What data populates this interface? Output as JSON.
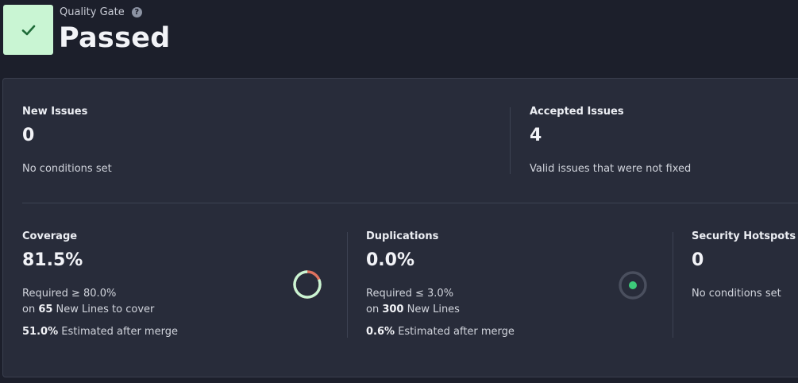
{
  "quality_gate": {
    "label": "Quality Gate",
    "help_icon": "?",
    "status": "Passed",
    "status_color": "#c9f5d3",
    "check_color": "#1e6b38"
  },
  "new_issues": {
    "title": "New Issues",
    "value": "0",
    "description": "No conditions set"
  },
  "accepted_issues": {
    "title": "Accepted Issues",
    "value": "4",
    "description": "Valid issues that were not fixed"
  },
  "coverage": {
    "title": "Coverage",
    "value": "81.5%",
    "required": "Required ≥ 80.0%",
    "on_prefix": "on ",
    "lines_count": "65",
    "lines_suffix": " New Lines to cover",
    "estimate_value": "51.0%",
    "estimate_suffix": " Estimated after merge",
    "ring_fraction": 0.815,
    "ring_covered_color": "#c9f5d3",
    "ring_uncovered_color": "#e0725f"
  },
  "duplications": {
    "title": "Duplications",
    "value": "0.0%",
    "required": "Required ≤ 3.0%",
    "on_prefix": "on ",
    "lines_count": "300",
    "lines_suffix": " New Lines",
    "estimate_value": "0.6%",
    "estimate_suffix": " Estimated after merge",
    "indicator_color": "#3dcb7a"
  },
  "security_hotspots": {
    "title": "Security Hotspots",
    "value": "0",
    "description": "No conditions set"
  }
}
